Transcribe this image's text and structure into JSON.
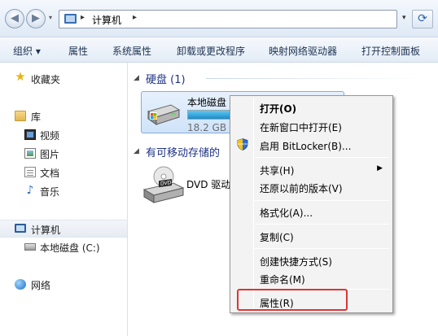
{
  "address": {
    "crumb": "计算机",
    "sep": "▸",
    "back_glyph": "◀",
    "fwd_glyph": "▶",
    "drop_glyph": "▾",
    "refresh_glyph": "⟳"
  },
  "toolbar": {
    "items": [
      "组织 ▾",
      "属性",
      "系统属性",
      "卸载或更改程序",
      "映射网络驱动器",
      "打开控制面板"
    ]
  },
  "sidebar": {
    "favorites": "收藏夹",
    "library": "库",
    "video": "视频",
    "pictures": "图片",
    "docs": "文档",
    "music": "音乐",
    "computer": "计算机",
    "local_disk": "本地磁盘 (C:)",
    "network": "网络"
  },
  "content": {
    "hdd_group": "硬盘 (1)",
    "removable_group": "有可移动存储的",
    "drive_name": "本地磁盘 (C",
    "drive_free": "18.2 GB",
    "drive_used_fraction": 0.68,
    "dvd_name": "DVD 驱动"
  },
  "context_menu": {
    "open": "打开(O)",
    "open_new_window": "在新窗口中打开(E)",
    "bitlocker": "启用 BitLocker(B)...",
    "share": "共享(H)",
    "restore": "还原以前的版本(V)",
    "format": "格式化(A)...",
    "copy": "复制(C)",
    "shortcut": "创建快捷方式(S)",
    "rename": "重命名(M)",
    "properties": "属性(R)",
    "submenu_arrow": "▶"
  },
  "colors": {
    "highlight": "#e03434",
    "group_header": "#1e3287"
  }
}
